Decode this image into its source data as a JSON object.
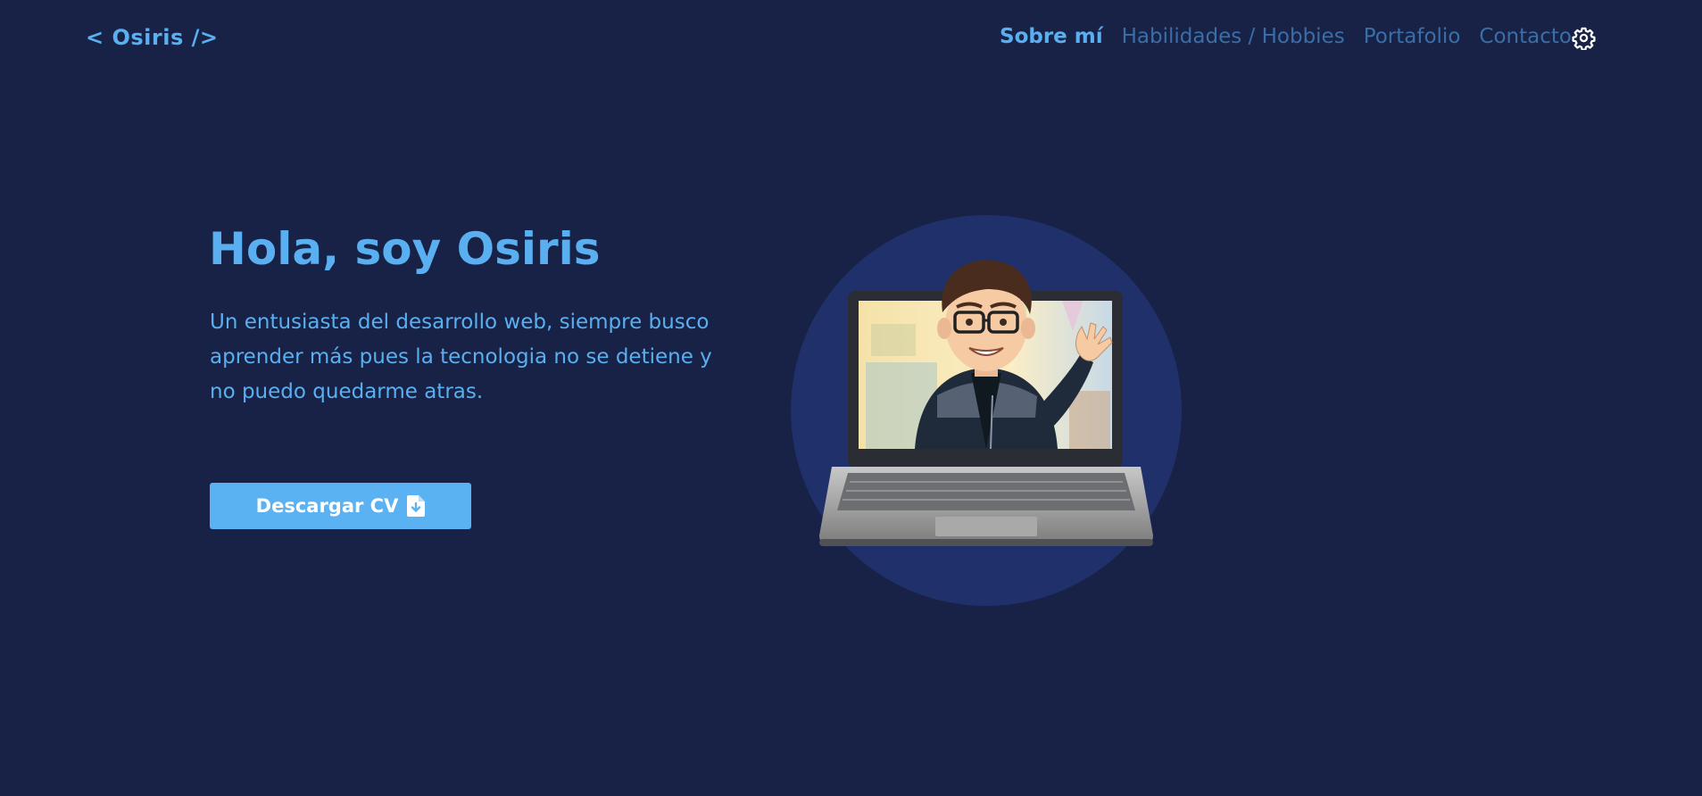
{
  "header": {
    "logo": "< Osiris />",
    "nav": [
      {
        "label": "Sobre mí",
        "active": true
      },
      {
        "label": "Habilidades / Hobbies",
        "active": false
      },
      {
        "label": "Portafolio",
        "active": false
      },
      {
        "label": "Contacto",
        "active": false
      }
    ],
    "settings_icon": "gear-icon"
  },
  "hero": {
    "title": "Hola, soy Osiris",
    "description": "Un entusiasta del desarrollo web, siempre busco aprender más pues la tecnologia no se detiene y no puedo quedarme atras.",
    "cv_button_label": "Descargar CV",
    "cv_button_icon": "file-download-icon",
    "illustration": "avatar-waving-from-laptop"
  },
  "colors": {
    "background": "#172246",
    "accent": "#5aaff0",
    "nav_inactive": "#3b6ea6",
    "button": "#5ab2f2",
    "avatar_circle": "#20306a"
  }
}
